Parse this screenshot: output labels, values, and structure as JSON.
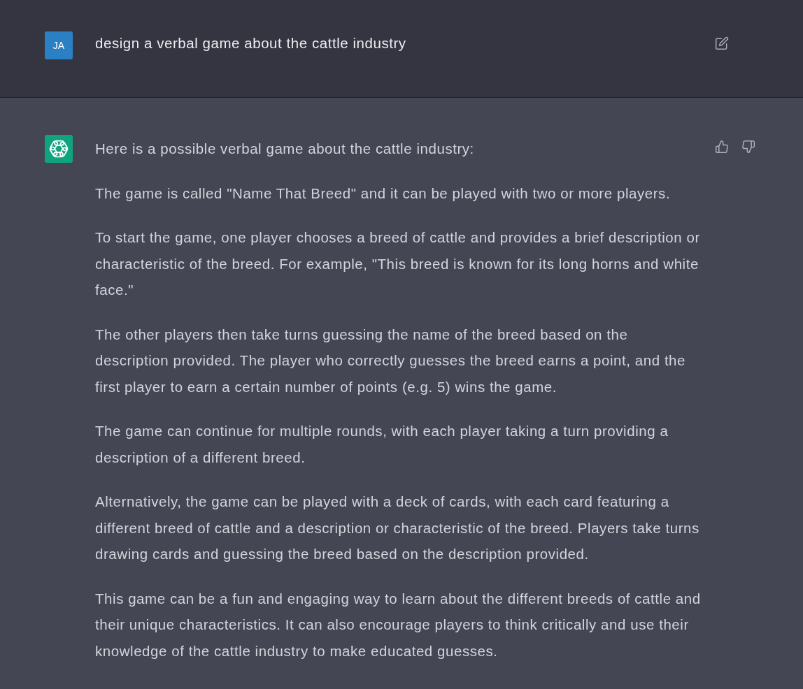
{
  "messages": [
    {
      "kind": "user",
      "avatar": "JA",
      "text": "design a verbal game about the cattle industry"
    },
    {
      "kind": "assistant",
      "paragraphs": [
        "Here is a possible verbal game about the cattle industry:",
        "The game is called \"Name That Breed\" and it can be played with two or more players.",
        "To start the game, one player chooses a breed of cattle and provides a brief description or characteristic of the breed. For example, \"This breed is known for its long horns and white face.\"",
        "The other players then take turns guessing the name of the breed based on the description provided. The player who correctly guesses the breed earns a point, and the first player to earn a certain number of points (e.g. 5) wins the game.",
        "The game can continue for multiple rounds, with each player taking a turn providing a description of a different breed.",
        "Alternatively, the game can be played with a deck of cards, with each card featuring a different breed of cattle and a description or characteristic of the breed. Players take turns drawing cards and guessing the breed based on the description provided.",
        "This game can be a fun and engaging way to learn about the different breeds of cattle and their unique characteristics. It can also encourage players to think critically and use their knowledge of the cattle industry to make educated guesses."
      ]
    }
  ]
}
